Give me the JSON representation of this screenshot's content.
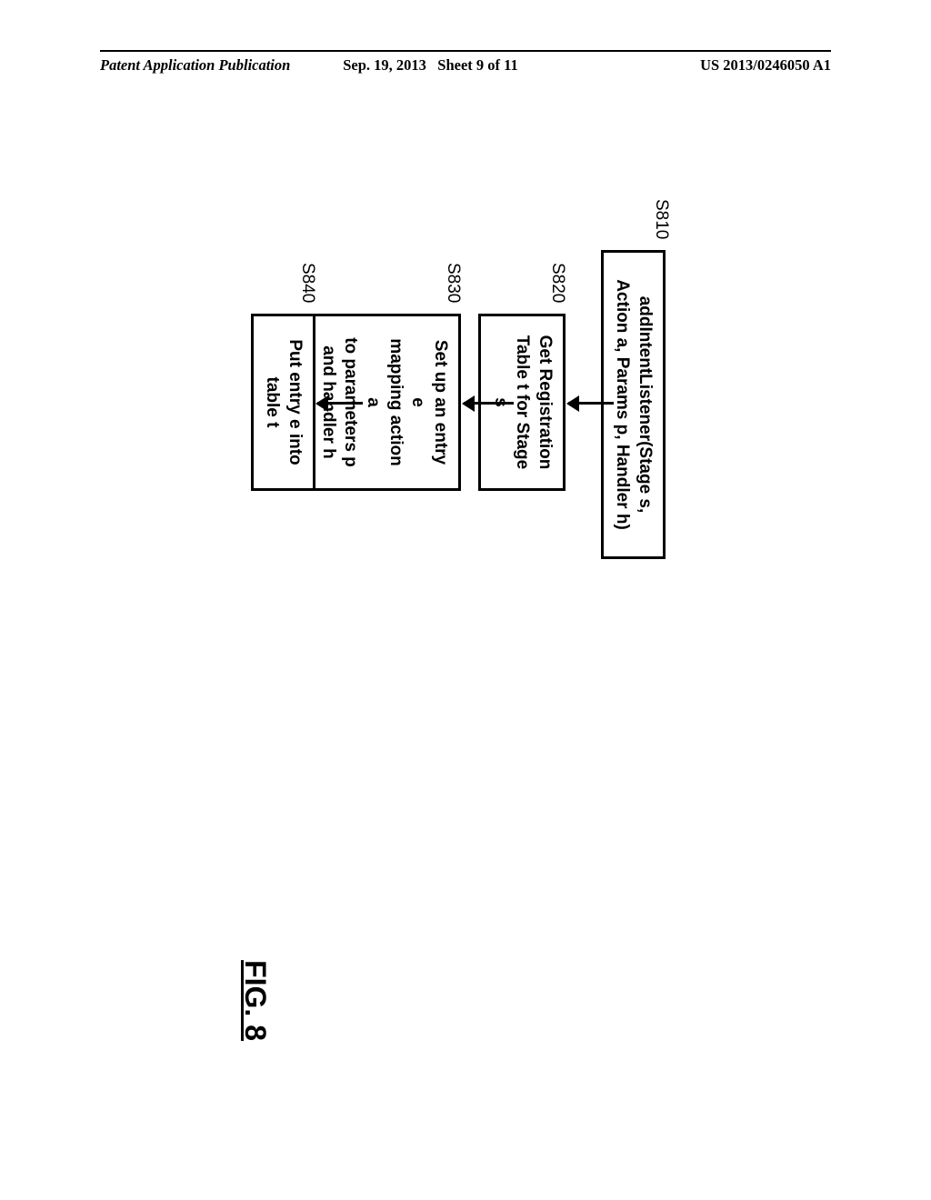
{
  "header": {
    "publication": "Patent Application Publication",
    "date": "Sep. 19, 2013",
    "sheet": "Sheet 9 of 11",
    "pubnum": "US 2013/0246050 A1"
  },
  "flowchart": {
    "box1": {
      "label": "S810",
      "text": "addIntentListener(Stage s, Action a, Params p, Handler h)"
    },
    "box2": {
      "label": "S820",
      "line1": "Get Registration",
      "line2": "Table t for Stage s"
    },
    "box3": {
      "label": "S830",
      "line1": "Set up an entry e",
      "line2": "mapping action a",
      "line3": "to parameters p",
      "line4": "and handler h"
    },
    "box4": {
      "label": "S840",
      "line1": "Put entry e into",
      "line2": "table t"
    }
  },
  "figure": "FIG. 8"
}
